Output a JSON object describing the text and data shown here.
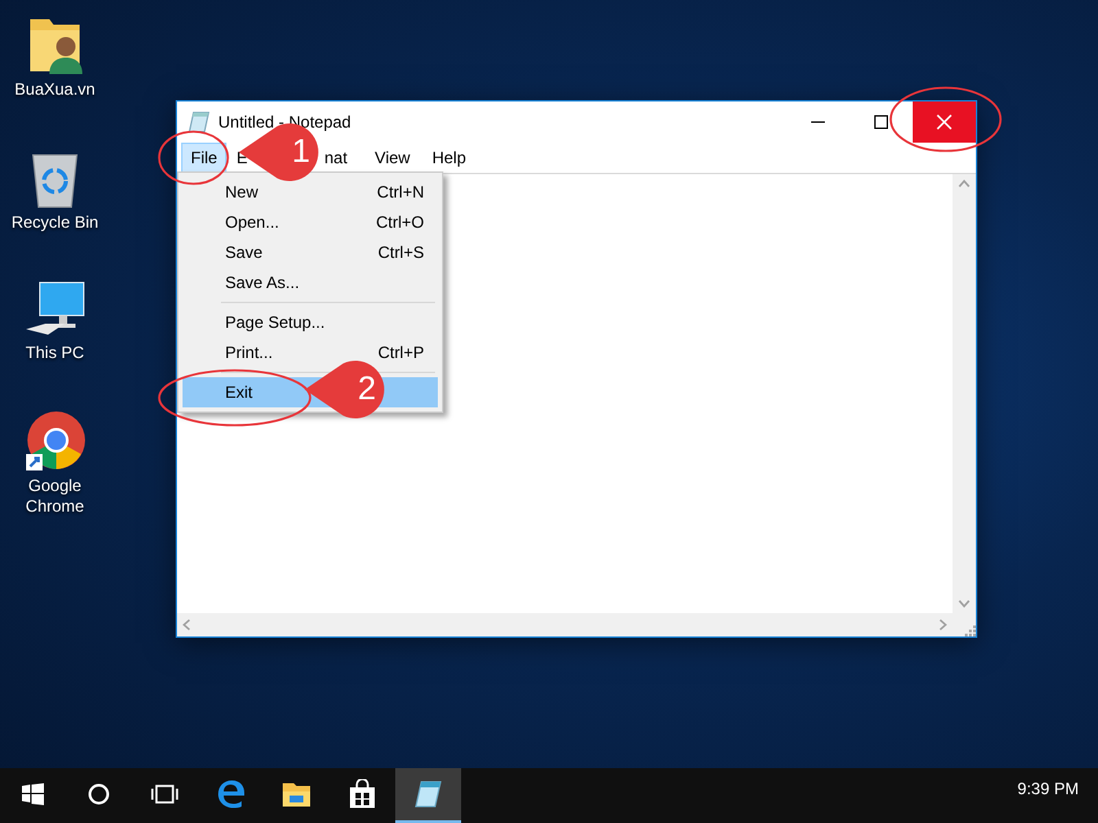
{
  "desktop_icons": [
    {
      "label": "BuaXua.vn",
      "kind": "folder"
    },
    {
      "label": "Recycle Bin",
      "kind": "recycle"
    },
    {
      "label": "This PC",
      "kind": "computer"
    },
    {
      "label": "Google Chrome",
      "kind": "browser"
    }
  ],
  "window": {
    "title": "Untitled - Notepad",
    "menu": [
      {
        "label": "File",
        "selected": true
      },
      {
        "label": "E",
        "selected": false
      },
      {
        "label": "nat",
        "selected": false
      },
      {
        "label": "View",
        "selected": false
      },
      {
        "label": "Help",
        "selected": false
      }
    ],
    "file_menu": [
      {
        "kind": "item",
        "label": "New",
        "shortcut": "Ctrl+N",
        "selected": false
      },
      {
        "kind": "item",
        "label": "Open...",
        "shortcut": "Ctrl+O",
        "selected": false
      },
      {
        "kind": "item",
        "label": "Save",
        "shortcut": "Ctrl+S",
        "selected": false
      },
      {
        "kind": "item",
        "label": "Save As...",
        "selected": false
      },
      {
        "kind": "separator"
      },
      {
        "kind": "item",
        "label": "Page Setup...",
        "selected": false
      },
      {
        "kind": "item",
        "label": "Print...",
        "shortcut": "Ctrl+P",
        "selected": false
      },
      {
        "kind": "separator"
      },
      {
        "kind": "item",
        "label": "Exit",
        "selected": true
      }
    ]
  },
  "callouts": [
    {
      "label": "1"
    },
    {
      "label": "2"
    }
  ],
  "taskbar": {
    "apps": [
      {
        "kind": "start",
        "selected": false
      },
      {
        "kind": "search",
        "selected": false
      },
      {
        "kind": "taskview",
        "selected": false
      },
      {
        "kind": "browser",
        "selected": false
      },
      {
        "kind": "explorer",
        "selected": false
      },
      {
        "kind": "store",
        "selected": false
      },
      {
        "kind": "notepad",
        "selected": true
      }
    ],
    "clock": "9:39 PM"
  }
}
